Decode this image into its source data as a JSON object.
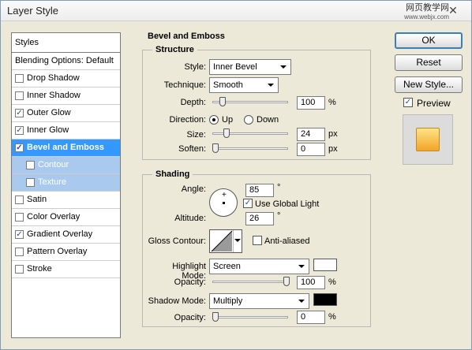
{
  "window": {
    "title": "Layer Style",
    "watermark_line1": "网页教学网",
    "watermark_line2": "www.webjx.com",
    "close_glyph": "✕"
  },
  "styles_panel": {
    "header": "Styles",
    "blending": "Blending Options: Default",
    "items": [
      {
        "label": "Drop Shadow",
        "checked": false
      },
      {
        "label": "Inner Shadow",
        "checked": false
      },
      {
        "label": "Outer Glow",
        "checked": true
      },
      {
        "label": "Inner Glow",
        "checked": true
      },
      {
        "label": "Bevel and Emboss",
        "checked": true,
        "selected": true
      },
      {
        "label": "Contour",
        "checked": false,
        "sub": true
      },
      {
        "label": "Texture",
        "checked": false,
        "sub": true
      },
      {
        "label": "Satin",
        "checked": false
      },
      {
        "label": "Color Overlay",
        "checked": false
      },
      {
        "label": "Gradient Overlay",
        "checked": true
      },
      {
        "label": "Pattern Overlay",
        "checked": false
      },
      {
        "label": "Stroke",
        "checked": false
      }
    ]
  },
  "bevel": {
    "title": "Bevel and Emboss",
    "structure": {
      "title": "Structure",
      "style_label": "Style:",
      "style_value": "Inner Bevel",
      "technique_label": "Technique:",
      "technique_value": "Smooth",
      "depth_label": "Depth:",
      "depth_value": "100",
      "depth_unit": "%",
      "depth_slider": 0.1,
      "direction_label": "Direction:",
      "direction_up": "Up",
      "direction_down": "Down",
      "direction_selected": "Up",
      "size_label": "Size:",
      "size_value": "24",
      "size_unit": "px",
      "size_slider": 0.16,
      "soften_label": "Soften:",
      "soften_value": "0",
      "soften_unit": "px",
      "soften_slider": 0
    },
    "shading": {
      "title": "Shading",
      "angle_label": "Angle:",
      "angle_value": "85",
      "angle_unit": "°",
      "global_light_label": "Use Global Light",
      "global_light_checked": true,
      "altitude_label": "Altitude:",
      "altitude_value": "26",
      "altitude_unit": "°",
      "gloss_label": "Gloss Contour:",
      "antialiased_label": "Anti-aliased",
      "antialiased_checked": false,
      "highlight_mode_label": "Highlight Mode:",
      "highlight_mode_value": "Screen",
      "highlight_color": "#ffffff",
      "highlight_opacity_label": "Opacity:",
      "highlight_opacity_value": "100",
      "highlight_opacity_unit": "%",
      "highlight_opacity_slider": 1.0,
      "shadow_mode_label": "Shadow Mode:",
      "shadow_mode_value": "Multiply",
      "shadow_color": "#000000",
      "shadow_opacity_label": "Opacity:",
      "shadow_opacity_value": "0",
      "shadow_opacity_unit": "%",
      "shadow_opacity_slider": 0
    }
  },
  "buttons": {
    "ok": "OK",
    "reset": "Reset",
    "new_style": "New Style...",
    "preview_label": "Preview",
    "preview_checked": true
  },
  "colors": {
    "selection": "#3399ff",
    "sub_selection": "#a9c9ee",
    "preview_top": "#ffe487",
    "preview_bottom": "#f2a427"
  }
}
